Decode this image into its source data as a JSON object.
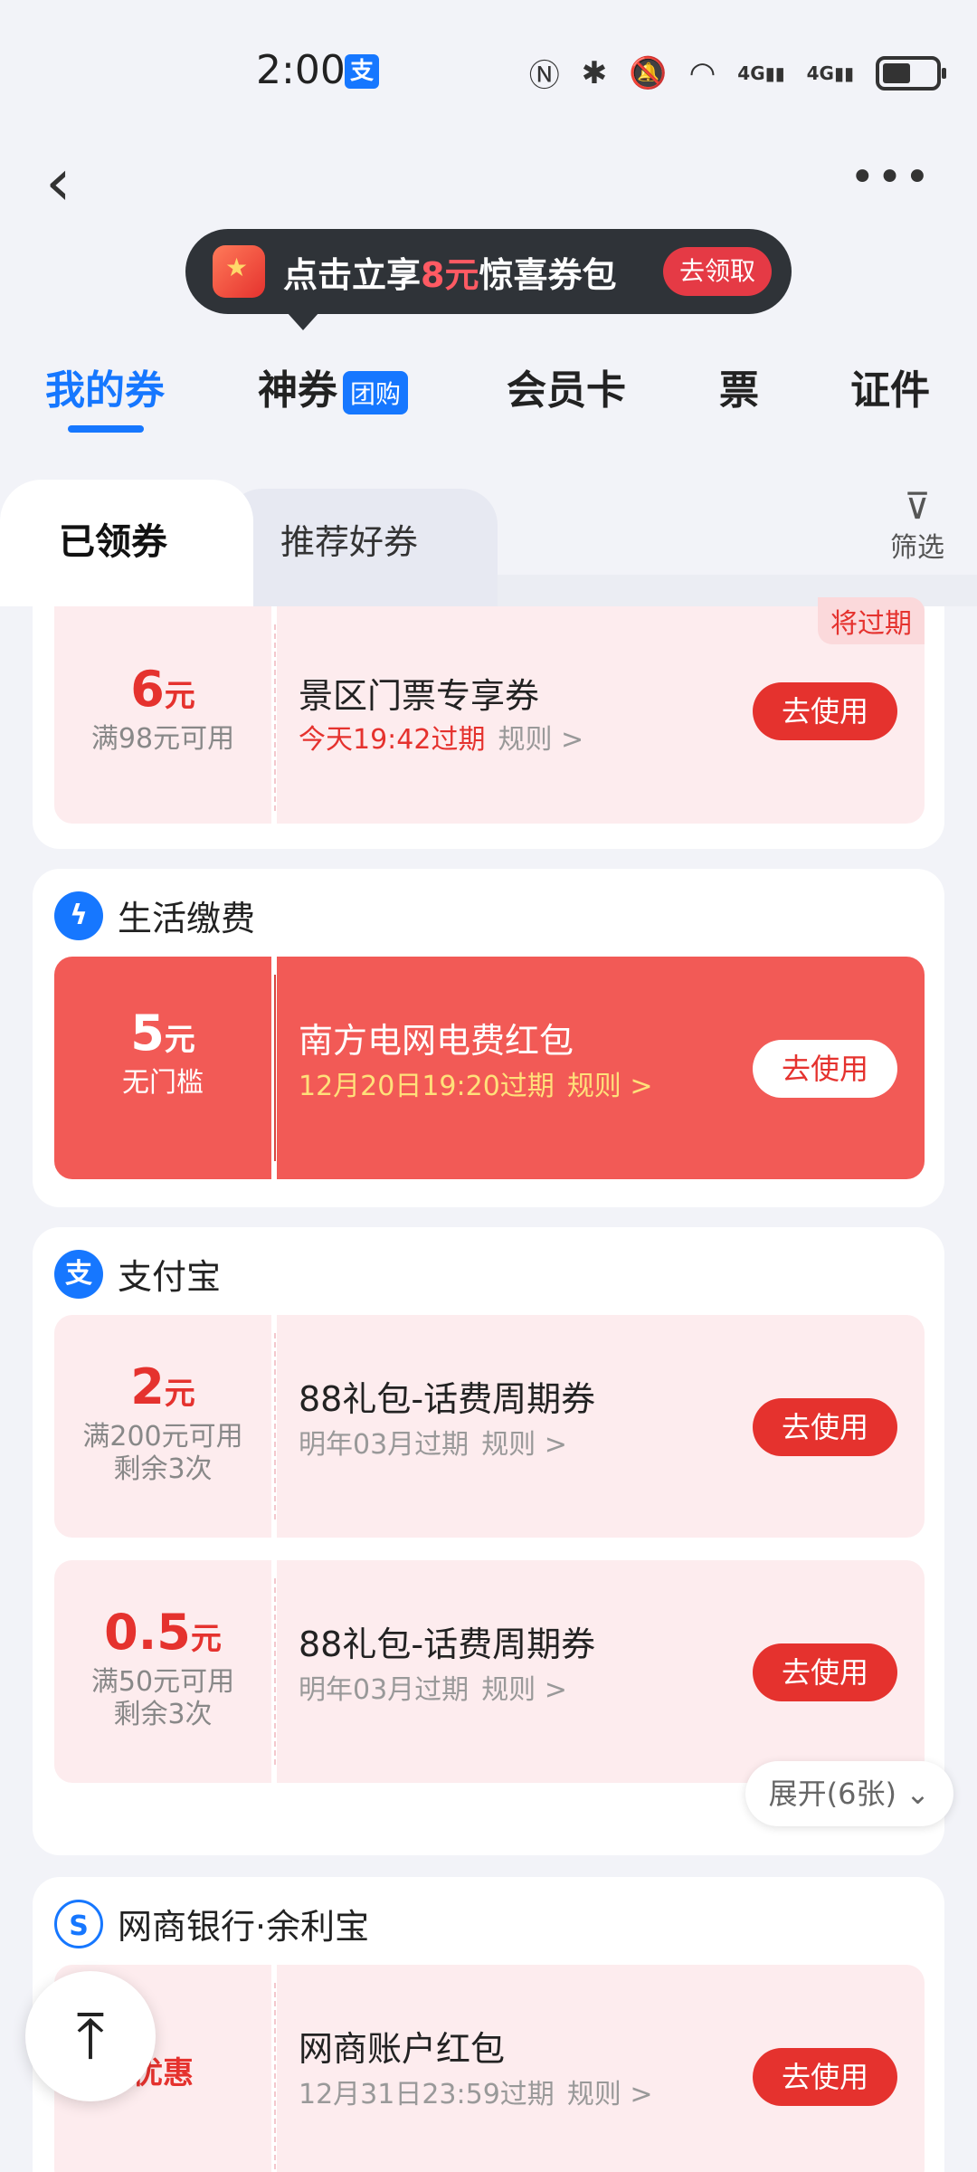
{
  "status": {
    "time": "2:00",
    "app_badge": "支",
    "icons": [
      "nfc-icon",
      "bluetooth-icon",
      "mute-icon",
      "wifi-icon",
      "signal-4g-icon",
      "signal-4g-icon",
      "battery-icon"
    ],
    "signal_label": "4G"
  },
  "banner": {
    "prefix": "点击立享",
    "highlight": "8元",
    "suffix": "惊喜券包",
    "button": "去领取"
  },
  "tabs": [
    {
      "label": "我的券"
    },
    {
      "label": "神券",
      "badge": "团购"
    },
    {
      "label": "会员卡"
    },
    {
      "label": "票"
    },
    {
      "label": "证件"
    }
  ],
  "subtabs": {
    "active": "已领券",
    "other": "推荐好券",
    "filter": "筛选"
  },
  "cards": [
    {
      "coupons": [
        {
          "amount": "6",
          "unit": "元",
          "cond1": "满98元可用",
          "name": "景区门票专享券",
          "expire": "今天19:42过期",
          "rule": "规则 >",
          "button": "去使用",
          "tag": "将过期"
        }
      ]
    },
    {
      "title": "生活缴费",
      "coupons": [
        {
          "amount": "5",
          "unit": "元",
          "cond1": "无门槛",
          "name": "南方电网电费红包",
          "expire": "12月20日19:20过期",
          "rule": "规则 >",
          "button": "去使用"
        }
      ]
    },
    {
      "title": "支付宝",
      "icon_text": "支",
      "coupons": [
        {
          "amount": "2",
          "unit": "元",
          "cond1": "满200元可用",
          "cond2": "剩余3次",
          "name": "88礼包-话费周期券",
          "expire": "明年03月过期",
          "rule": "规则 >",
          "button": "去使用"
        },
        {
          "amount": "0.5",
          "unit": "元",
          "cond1": "满50元可用",
          "cond2": "剩余3次",
          "name": "88礼包-话费周期券",
          "expire": "明年03月过期",
          "rule": "规则 >",
          "button": "去使用"
        }
      ],
      "expand": "展开(6张) ⌄"
    },
    {
      "title": "网商银行·余利宝",
      "coupons": [
        {
          "amount": "优惠",
          "name": "网商账户红包",
          "expire": "12月31日23:59过期",
          "rule": "规则 >",
          "button": "去使用"
        }
      ]
    }
  ]
}
